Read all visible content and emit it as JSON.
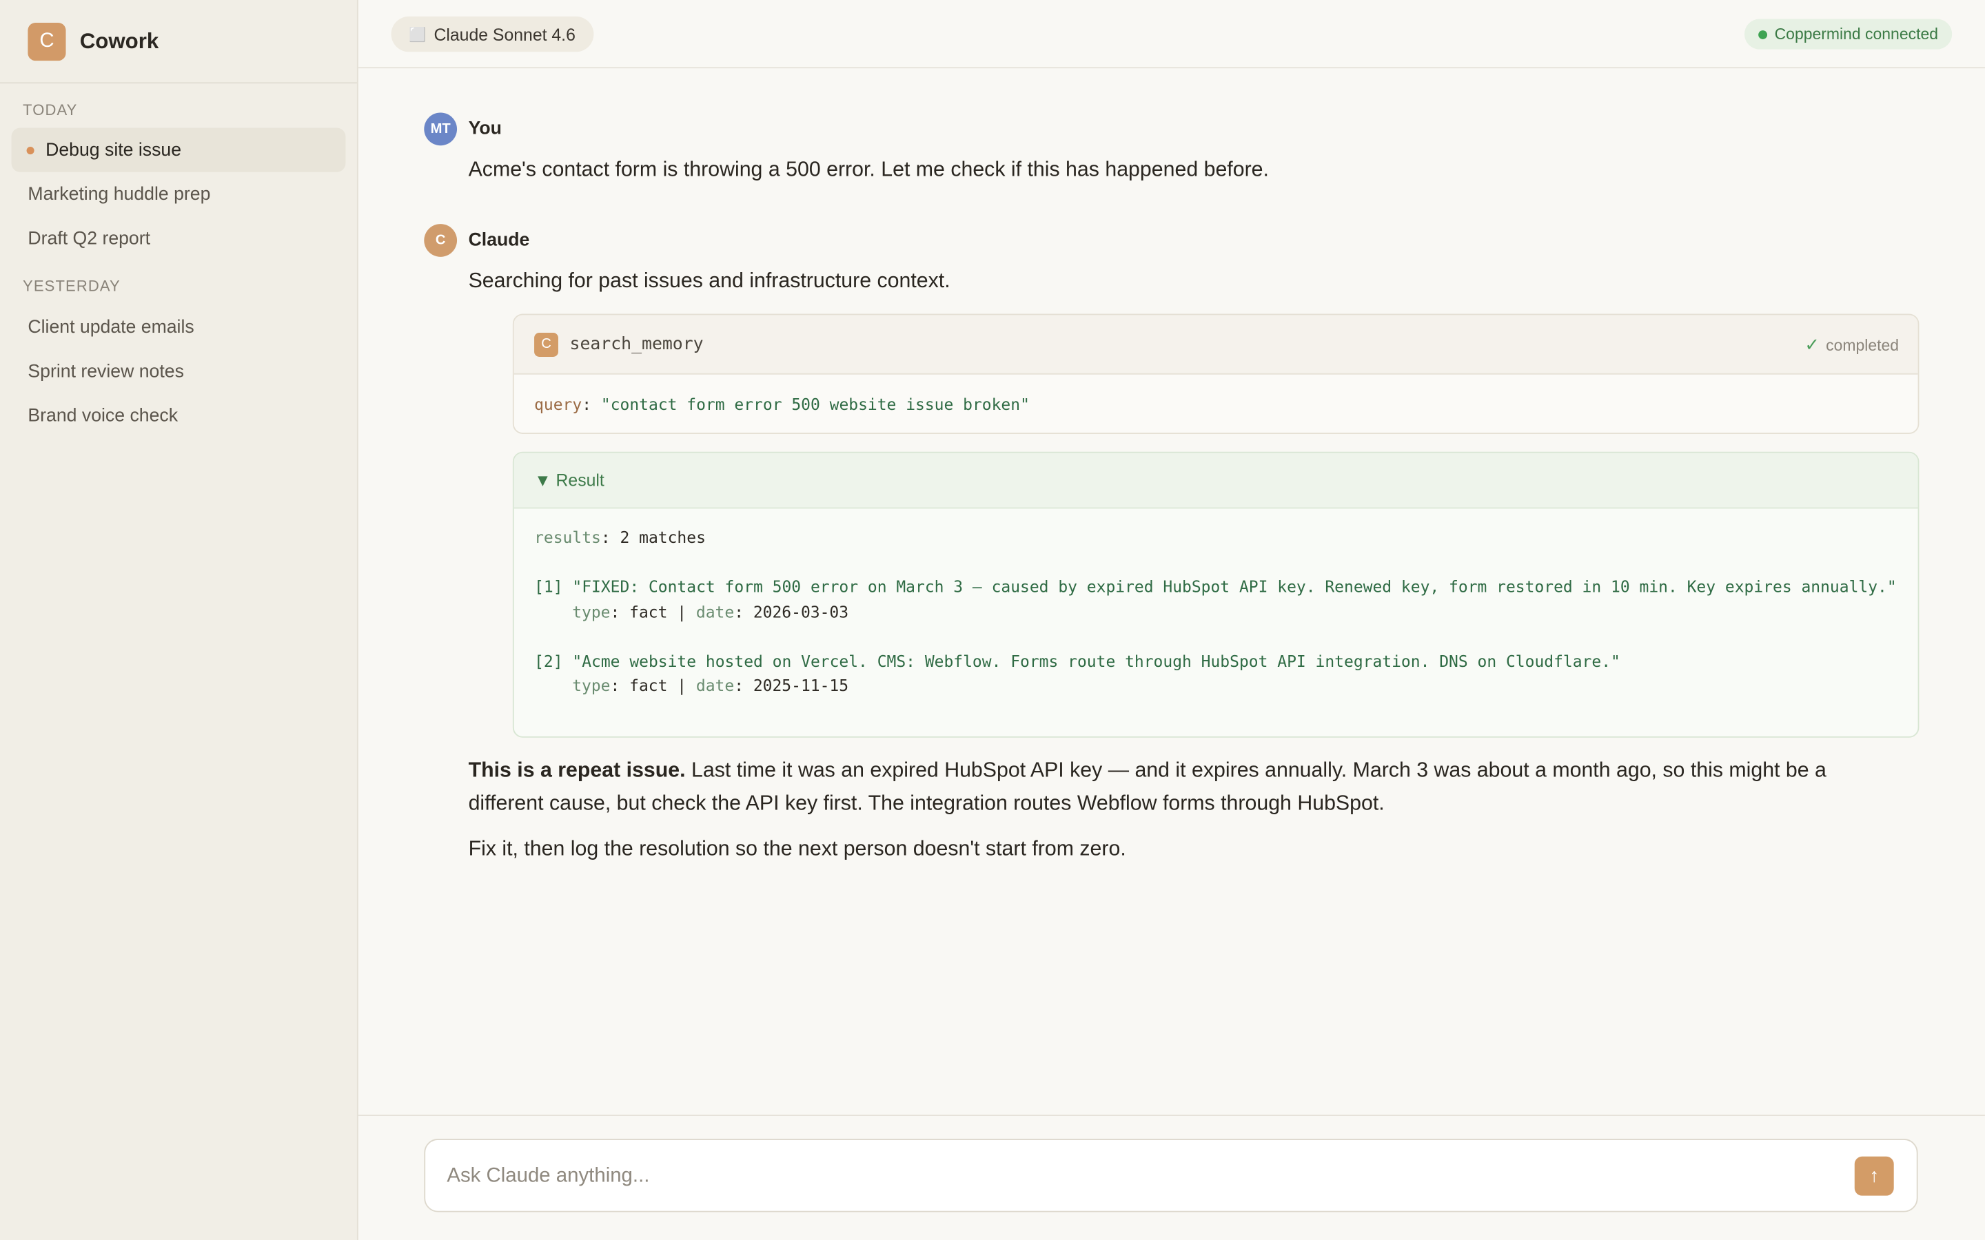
{
  "app": {
    "logo_letter": "C",
    "name": "Cowork"
  },
  "sidebar": {
    "sections": [
      {
        "label": "TODAY",
        "items": [
          "Debug site issue",
          "Marketing huddle prep",
          "Draft Q2 report"
        ]
      },
      {
        "label": "YESTERDAY",
        "items": [
          "Client update emails",
          "Sprint review notes",
          "Brand voice check"
        ]
      }
    ],
    "active_item": "Debug site issue"
  },
  "topbar": {
    "model": "Claude Sonnet 4.6",
    "model_icon": "⬜",
    "connection": "Coppermind connected"
  },
  "messages": {
    "user": {
      "avatar": "MT",
      "name": "You",
      "text": "Acme's contact form is throwing a 500 error. Let me check if this has happened before."
    },
    "assistant": {
      "avatar": "C",
      "name": "Claude",
      "text": "Searching for past issues and infrastructure context.",
      "tool": {
        "icon": "C",
        "name": "search_memory",
        "status_icon": "✓",
        "status": "completed",
        "arg_key": "query",
        "arg_sep": ": ",
        "arg_value": "\"contact form error 500 website issue broken\""
      },
      "result": {
        "toggle": "▼ Result",
        "summary_key": "results",
        "summary_value": ": 2 matches",
        "items": [
          {
            "index": "[1]",
            "text": "\"FIXED: Contact form 500 error on March 3 — caused by expired HubSpot API key. Renewed key, form restored in 10 min. Key expires annually.\"",
            "type_key": "type",
            "type_value": ": fact | ",
            "date_key": "date",
            "date_value": ": 2026-03-03"
          },
          {
            "index": "[2]",
            "text": "\"Acme website hosted on Vercel. CMS: Webflow. Forms route through HubSpot API integration. DNS on Cloudflare.\"",
            "type_key": "type",
            "type_value": ": fact | ",
            "date_key": "date",
            "date_value": ": 2025-11-15"
          }
        ]
      },
      "final_bold": "This is a repeat issue.",
      "final_rest": " Last time it was an expired HubSpot API key — and it expires annually. March 3 was about a month ago, so this might be a different cause, but check the API key first. The integration routes Webflow forms through HubSpot.",
      "final_line2": "Fix it, then log the resolution so the next person doesn't start from zero."
    }
  },
  "input": {
    "placeholder": "Ask Claude anything...",
    "send_icon": "↑"
  },
  "colors": {
    "accent": "#d39c67",
    "user_avatar": "#6b86c7",
    "connected": "#3ea352"
  }
}
